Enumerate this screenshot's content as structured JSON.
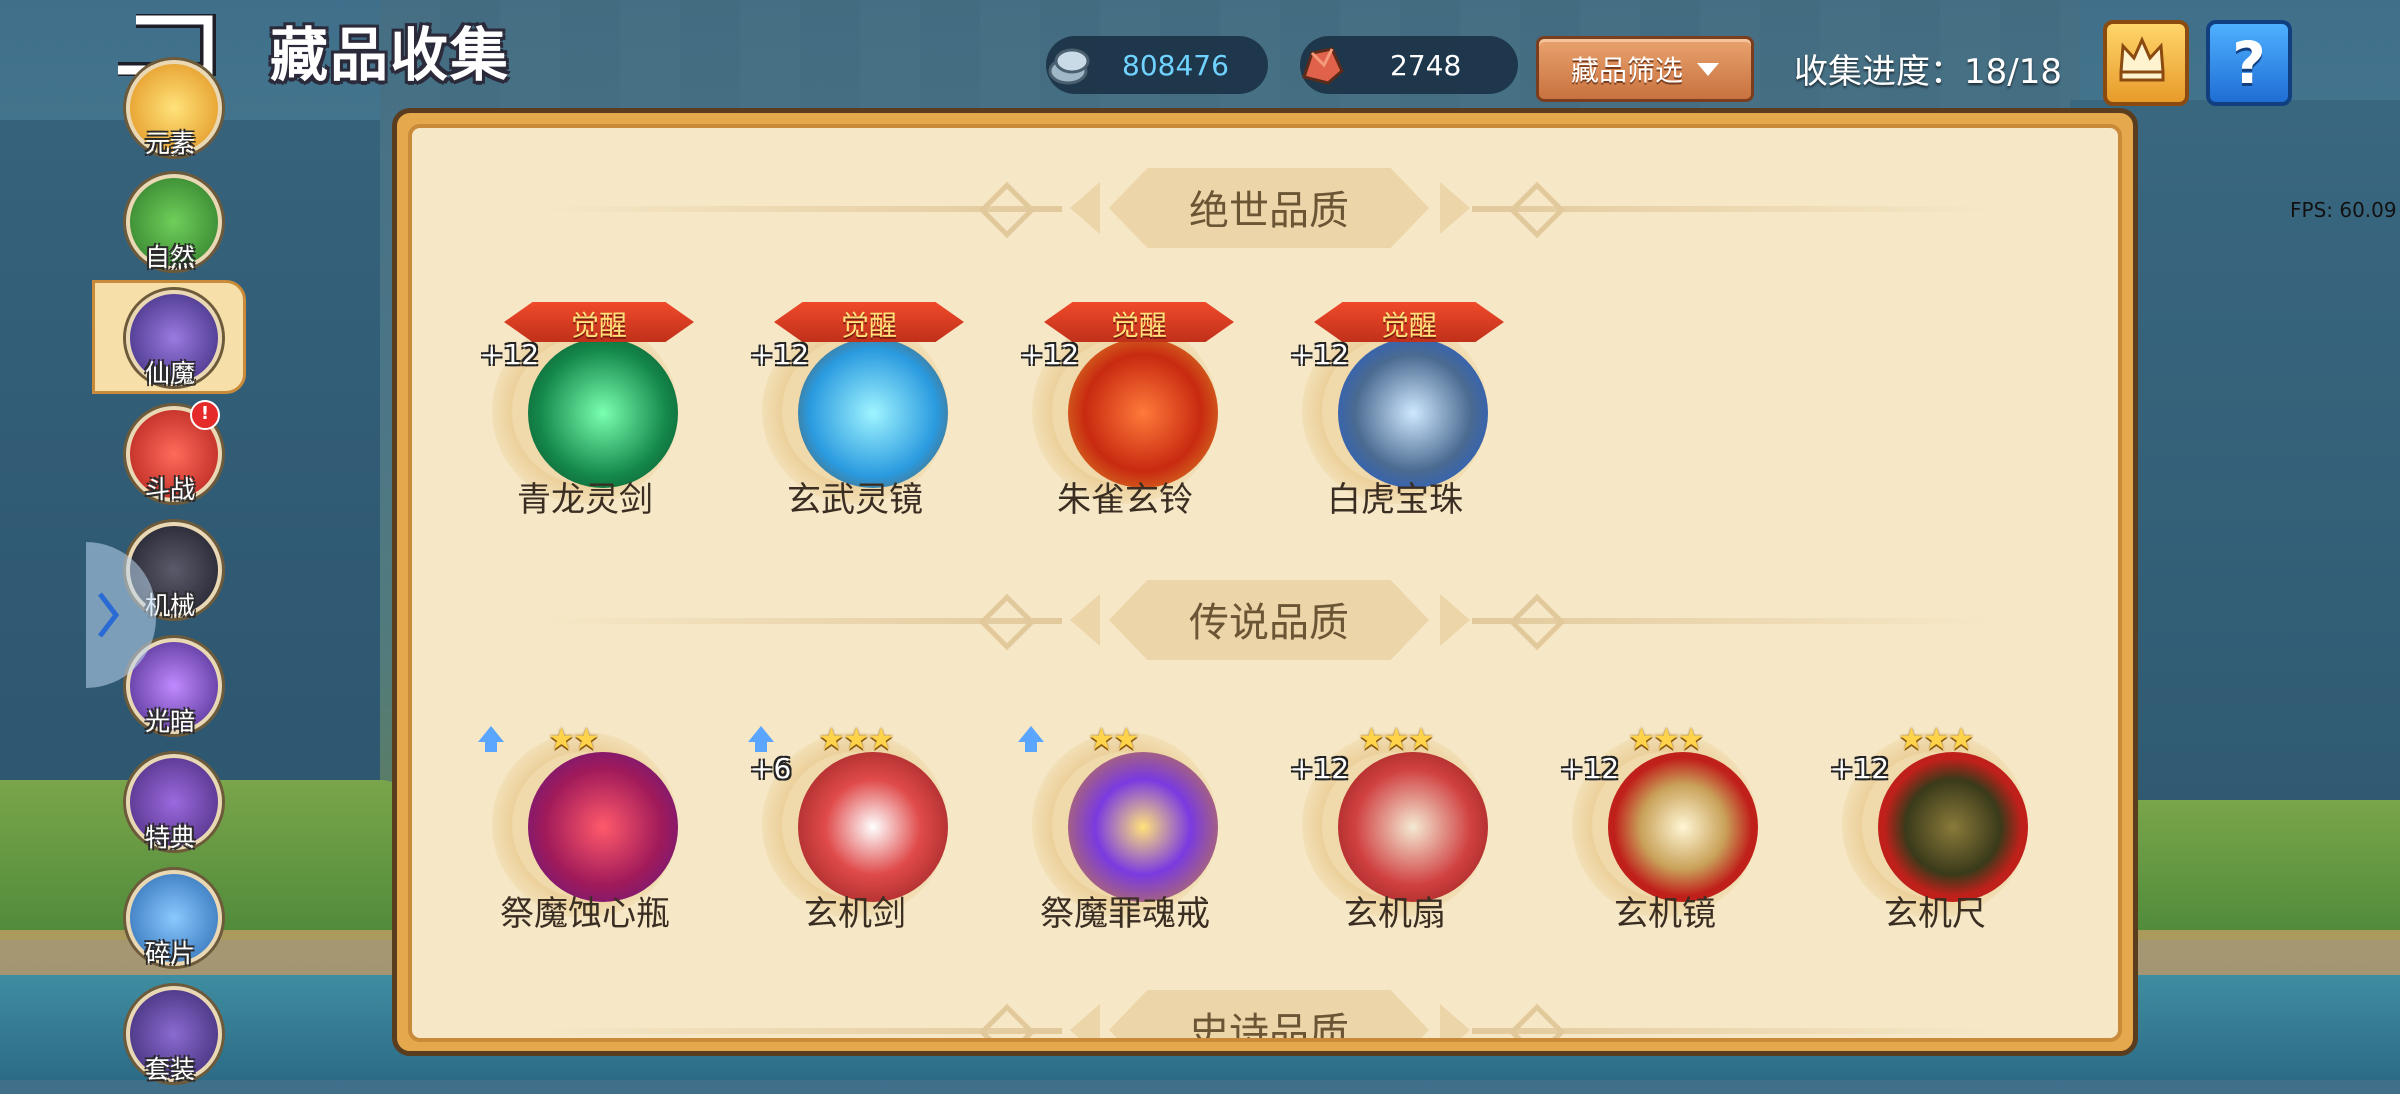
{
  "header": {
    "title": "藏品收集",
    "silver_amount": "808476",
    "gem_amount": "2748",
    "filter_label": "藏品筛选",
    "progress_label": "收集进度：18/18",
    "help_label": "?"
  },
  "fps": "FPS: 60.09",
  "sidebar": {
    "items": [
      {
        "label": "元素"
      },
      {
        "label": "自然"
      },
      {
        "label": "仙魔"
      },
      {
        "label": "斗战",
        "alert": "!"
      },
      {
        "label": "机械"
      },
      {
        "label": "光暗"
      },
      {
        "label": "特典"
      },
      {
        "label": "碎片"
      },
      {
        "label": "套装"
      }
    ]
  },
  "sections": [
    {
      "title": "绝世品质",
      "items": [
        {
          "name": "青龙灵剑",
          "level": "+12",
          "badge": "觉醒"
        },
        {
          "name": "玄武灵镜",
          "level": "+12",
          "badge": "觉醒"
        },
        {
          "name": "朱雀玄铃",
          "level": "+12",
          "badge": "觉醒"
        },
        {
          "name": "白虎宝珠",
          "level": "+12",
          "badge": "觉醒"
        }
      ]
    },
    {
      "title": "传说品质",
      "items": [
        {
          "name": "祭魔蚀心瓶",
          "stars": "★★"
        },
        {
          "name": "玄机剑",
          "level": "+6",
          "stars": "★★★"
        },
        {
          "name": "祭魔罪魂戒",
          "stars": "★★"
        },
        {
          "name": "玄机扇",
          "level": "+12",
          "stars": "★★★"
        },
        {
          "name": "玄机镜",
          "level": "+12",
          "stars": "★★★"
        },
        {
          "name": "玄机尺",
          "level": "+12",
          "stars": "★★★"
        }
      ]
    },
    {
      "title": "史诗品质"
    }
  ],
  "colors": {
    "panel_bg": "#f6e7c6",
    "panel_border": "#c98a3a",
    "filter_button": "#c8723f",
    "silver_text": "#6fd2ff"
  }
}
